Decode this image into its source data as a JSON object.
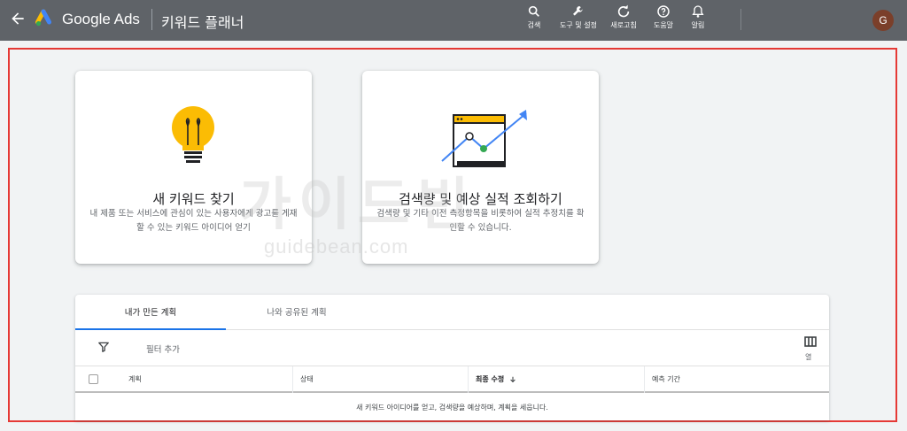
{
  "header": {
    "brand": "Google Ads",
    "page_title": "키워드 플래너",
    "tools": [
      {
        "label": "검색",
        "icon": "search-icon"
      },
      {
        "label": "도구 및 설정",
        "icon": "wrench-icon"
      },
      {
        "label": "새로고침",
        "icon": "refresh-icon"
      },
      {
        "label": "도움말",
        "icon": "help-icon"
      },
      {
        "label": "알림",
        "icon": "bell-icon"
      }
    ],
    "avatar_initial": "G"
  },
  "cards": [
    {
      "title": "새 키워드 찾기",
      "description": "내 제품 또는 서비스에 관심이 있는 사용자에게 광고를 게재할 수 있는 키워드 아이디어 얻기"
    },
    {
      "title": "검색량 및 예상 실적 조회하기",
      "description": "검색량 및 기타 이전 측정항목을 비롯하여 실적 추정치를 확인할 수 있습니다."
    }
  ],
  "watermark": {
    "text": "가이드빈",
    "url": "guidebean.com"
  },
  "plans": {
    "tabs": [
      "내가 만든 계획",
      "나와 공유된 계획"
    ],
    "filter_label": "필터 추가",
    "columns_label": "열",
    "headers": [
      "계획",
      "상태",
      "최종 수정",
      "예측 기간"
    ],
    "empty_message": "새 키워드 아이디어를 얻고, 검색량을 예상하며, 계획을 세웁니다."
  },
  "colors": {
    "topbar": "#5f6368",
    "accent": "#1a73e8",
    "annotation": "#e53935",
    "bulb": "#fbbc04"
  }
}
